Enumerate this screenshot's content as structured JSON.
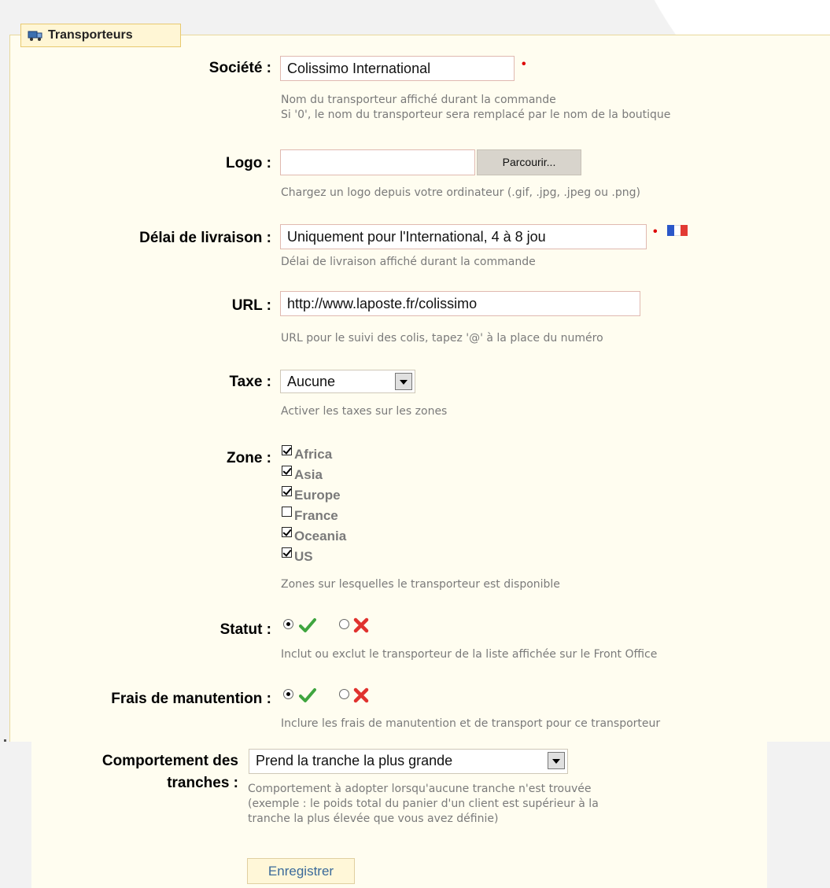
{
  "fieldset": {
    "legend": "Transporteurs"
  },
  "societe": {
    "label": "Société :",
    "value": "Colissimo International",
    "required_mark": "•",
    "hint1": "Nom du transporteur affiché durant la commande",
    "hint2": "Si '0', le nom du transporteur sera remplacé par le nom de la boutique"
  },
  "logo": {
    "label": "Logo :",
    "value": "",
    "browse_label": "Parcourir...",
    "hint": "Chargez un logo depuis votre ordinateur (.gif, .jpg, .jpeg ou .png)"
  },
  "delai": {
    "label": "Délai de livraison :",
    "value": "Uniquement pour l'International, 4 à 8 jou",
    "required_mark": "•",
    "hint": "Délai de livraison affiché durant la commande"
  },
  "url": {
    "label": "URL :",
    "value": "http://www.laposte.fr/colissimo",
    "hint": "URL pour le suivi des colis, tapez '@' à la place du numéro"
  },
  "taxe": {
    "label": "Taxe :",
    "selected": "Aucune",
    "hint": "Activer les taxes sur les zones"
  },
  "zone": {
    "label": "Zone :",
    "items": [
      {
        "label": "Africa",
        "checked": true
      },
      {
        "label": "Asia",
        "checked": true
      },
      {
        "label": "Europe",
        "checked": true
      },
      {
        "label": "France",
        "checked": false
      },
      {
        "label": "Oceania",
        "checked": true
      },
      {
        "label": "US",
        "checked": true
      }
    ],
    "hint": "Zones sur lesquelles le transporteur est disponible"
  },
  "statut": {
    "label": "Statut :",
    "selected": "yes",
    "hint": "Inclut ou exclut le transporteur de la liste affichée sur le Front Office"
  },
  "frais": {
    "label": "Frais de manutention :",
    "selected": "yes",
    "hint": "Inclure les frais de manutention et de transport pour ce transporteur"
  },
  "comportement": {
    "label_line1": "Comportement des",
    "label_line2": "tranches :",
    "selected": "Prend la tranche la plus grande",
    "hint1": "Comportement à adopter lorsqu'aucune tranche n'est trouvée",
    "hint2": "(exemple : le poids total du panier d'un client est supérieur à la",
    "hint3": "tranche la plus élevée que vous avez définie)"
  },
  "save": {
    "label": "Enregistrer"
  },
  "colors": {
    "panel": "#fffdf0",
    "accept": "#3fa53f",
    "reject": "#e0322e",
    "required": "#dd0000"
  }
}
